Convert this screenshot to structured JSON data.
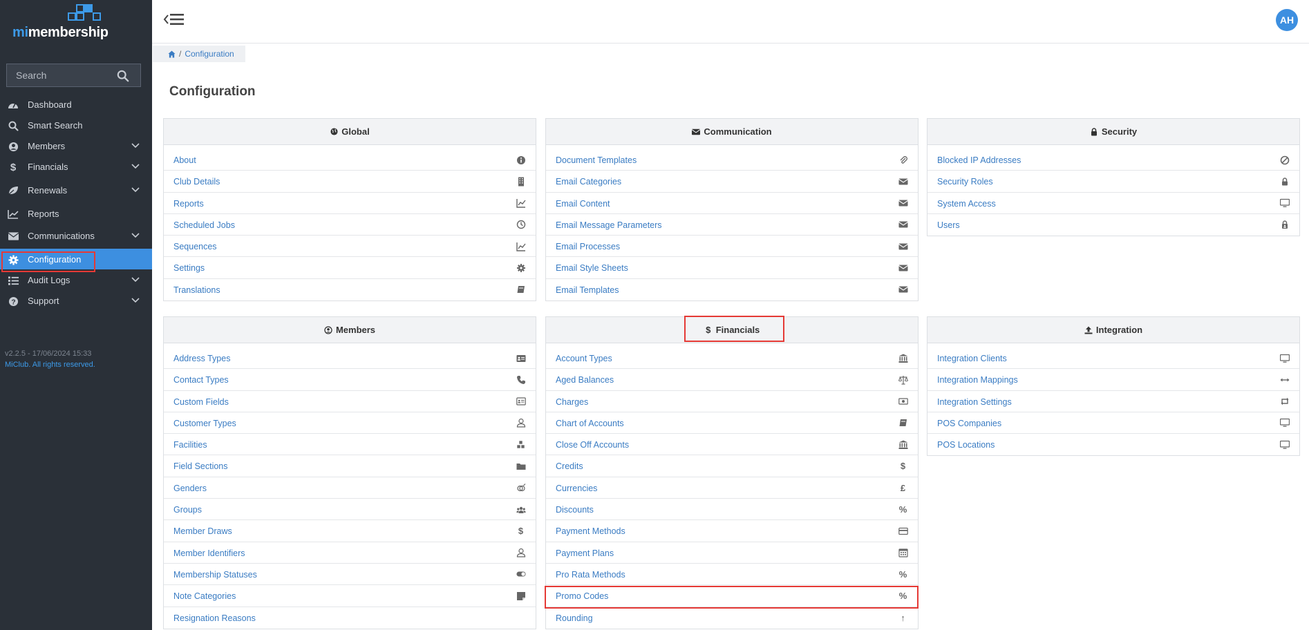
{
  "brand": {
    "prefix": "mi",
    "suffix": "membership"
  },
  "search": {
    "placeholder": "Search"
  },
  "sidebar": {
    "items": [
      {
        "label": "Dashboard"
      },
      {
        "label": "Smart Search"
      },
      {
        "label": "Members"
      },
      {
        "label": "Financials"
      },
      {
        "label": "Renewals"
      },
      {
        "label": "Reports"
      },
      {
        "label": "Communications"
      },
      {
        "label": "Configuration"
      },
      {
        "label": "Audit Logs"
      },
      {
        "label": "Support"
      }
    ],
    "version": "v2.2.5 - 17/06/2024 15:33",
    "copyright": "MiClub. All rights reserved."
  },
  "user": {
    "initials": "AH"
  },
  "breadcrumb": {
    "current": "Configuration"
  },
  "page": {
    "title": "Configuration"
  },
  "panels": {
    "global": {
      "title": "Global",
      "items": [
        "About",
        "Club Details",
        "Reports",
        "Scheduled Jobs",
        "Sequences",
        "Settings",
        "Translations"
      ]
    },
    "communication": {
      "title": "Communication",
      "items": [
        "Document Templates",
        "Email Categories",
        "Email Content",
        "Email Message Parameters",
        "Email Processes",
        "Email Style Sheets",
        "Email Templates"
      ]
    },
    "security": {
      "title": "Security",
      "items": [
        "Blocked IP Addresses",
        "Security Roles",
        "System Access",
        "Users"
      ]
    },
    "members": {
      "title": "Members",
      "items": [
        "Address Types",
        "Contact Types",
        "Custom Fields",
        "Customer Types",
        "Facilities",
        "Field Sections",
        "Genders",
        "Groups",
        "Member Draws",
        "Member Identifiers",
        "Membership Statuses",
        "Note Categories",
        "Resignation Reasons"
      ]
    },
    "financials": {
      "title": "Financials",
      "items": [
        "Account Types",
        "Aged Balances",
        "Charges",
        "Chart of Accounts",
        "Close Off Accounts",
        "Credits",
        "Currencies",
        "Discounts",
        "Payment Methods",
        "Payment Plans",
        "Pro Rata Methods",
        "Promo Codes",
        "Rounding"
      ],
      "icon_glyphs": {
        "credits": "$",
        "currencies": "£",
        "percent": "%",
        "rounding": "↑"
      }
    },
    "integration": {
      "title": "Integration",
      "items": [
        "Integration Clients",
        "Integration Mappings",
        "Integration Settings",
        "POS Companies",
        "POS Locations"
      ]
    }
  },
  "colors": {
    "sidebar_bg": "#2a3038",
    "accent": "#3d8fe0",
    "link": "#3a7cc3",
    "highlight": "#e53935"
  }
}
